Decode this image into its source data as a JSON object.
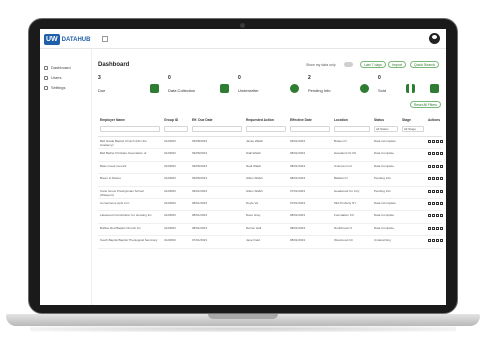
{
  "app": {
    "logo_mark": "UW",
    "logo_text": "DATAHUB"
  },
  "sidebar": {
    "items": [
      {
        "label": "Dashboard",
        "icon": "home-icon"
      },
      {
        "label": "Users",
        "icon": "users-icon"
      },
      {
        "label": "Settings",
        "icon": "gear-icon"
      }
    ]
  },
  "header": {
    "title": "Dashboard",
    "toggle_label": "Show my data only",
    "buttons": [
      "Last 7 days",
      "Import",
      "Quick Search"
    ]
  },
  "stats": [
    {
      "value": "3",
      "label": "Due",
      "icon": "clock-icon"
    },
    {
      "value": "0",
      "label": "Data Collection",
      "icon": "refresh-icon"
    },
    {
      "value": "0",
      "label": "Underwriter",
      "icon": "database-icon"
    },
    {
      "value": "2",
      "label": "Pending Info",
      "icon": "user-icon"
    },
    {
      "value": "0",
      "label": "Sold",
      "icon": "hourglass-icon"
    },
    {
      "value": "",
      "label": "",
      "icon": "check-icon"
    }
  ],
  "reset_label": "Reset All Filters",
  "table": {
    "headers": [
      "Employer Name",
      "Group ID",
      "Eff. Due Date",
      "Requested Action",
      "Effective Date",
      "Location",
      "Status",
      "Stage",
      "Actions"
    ],
    "filters": {
      "status": "All Status",
      "stage": "All Stage"
    },
    "rows": [
      [
        "Bell Grade Baptist Church (Dim the Academy)",
        "3123093",
        "09/08/2023",
        "Jamie Walsh",
        "09/01/2023",
        "Broken N",
        "Data Incomplete"
      ],
      [
        "Bell Bethel Christian Association of",
        "3123093",
        "09/05/2023",
        "Niall Walsh",
        "08/01/2023",
        "Haveland Ctr PA",
        "Data Complete"
      ],
      [
        "Bass Creek Council",
        "3123093",
        "09/05/2023",
        "Neal Walsh",
        "08/01/2023",
        "Unknown Ind",
        "Data Complete"
      ],
      [
        "Breen & Stokes",
        "3123093",
        "09/05/2023",
        "Gillen Walsh",
        "08/01/2023",
        "Baldwin N",
        "Pending Info"
      ],
      [
        "Cane Grove Presbyterian School (Wiseport)",
        "3123093",
        "09/01/2023",
        "Gillen Walsh",
        "07/01/2023",
        "Headwood Co Ctry",
        "Pending Info"
      ],
      [
        "Cornerstone Apts LLC",
        "3123093",
        "08/01/2023",
        "Doyle Va",
        "07/01/2023",
        "Mid-Timberly NY",
        "Data Incomplete"
      ],
      [
        "Lakewood Constitution Co Housing Inc",
        "3123093",
        "08/01/2023",
        "Dave Gray",
        "08/01/2023",
        "Foundation KC",
        "Data Complete"
      ],
      [
        "Bullbet Rod Baptist Church Inc",
        "3123093",
        "08/01/2023",
        "Darren Hall",
        "08/01/2023",
        "Northbrook N",
        "Data Complete"
      ],
      [
        "South Baptist Baptist Theological Seminary",
        "3123093",
        "07/01/2023",
        "Jane Field",
        "08/01/2023",
        "Westmood Ctr",
        "Underwriting"
      ]
    ]
  }
}
